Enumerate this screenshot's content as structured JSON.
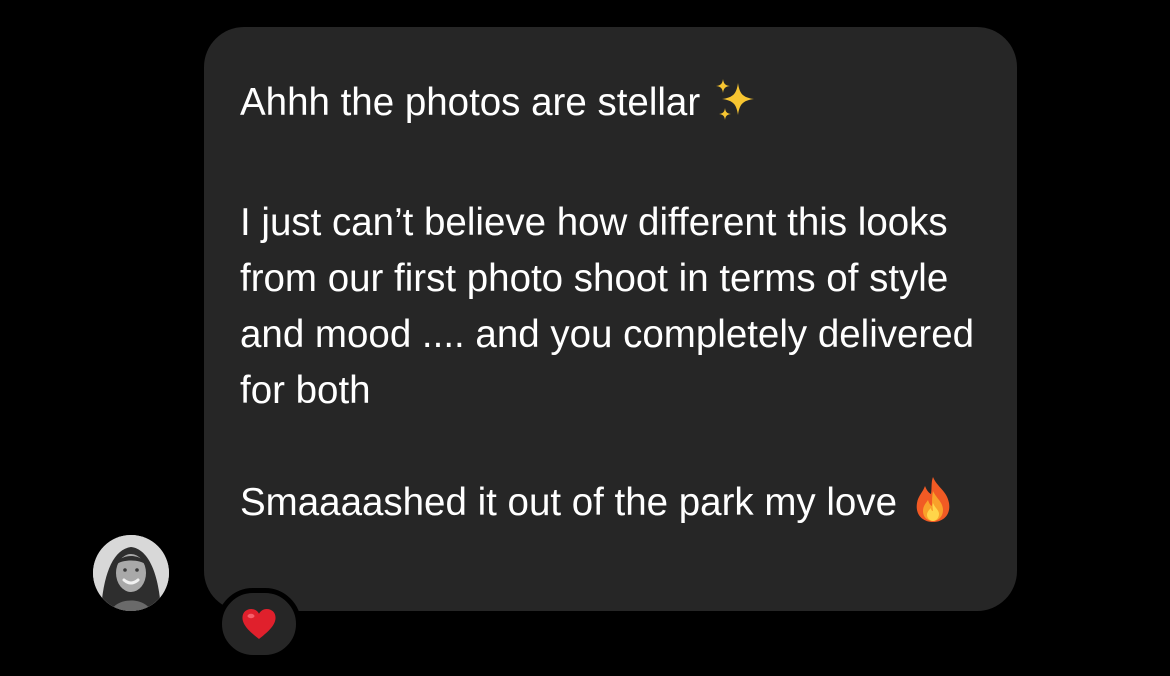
{
  "message": {
    "paragraphs": [
      "Ahhh the photos are stellar",
      "I just can’t believe how different this looks from our first photo shoot in terms of style and mood .... and you completely delivered for both",
      "Smaaaashed it out of the park my love"
    ],
    "emojis": {
      "paragraph_0": "sparkles-emoji",
      "paragraph_2": "fire-emoji"
    }
  },
  "sender": {
    "avatar_icon": "user-avatar-photo"
  },
  "reaction": {
    "icon": "red-heart-emoji",
    "color": "#e0202c"
  },
  "colors": {
    "background": "#000000",
    "bubble": "#262626",
    "text": "#ffffff"
  }
}
